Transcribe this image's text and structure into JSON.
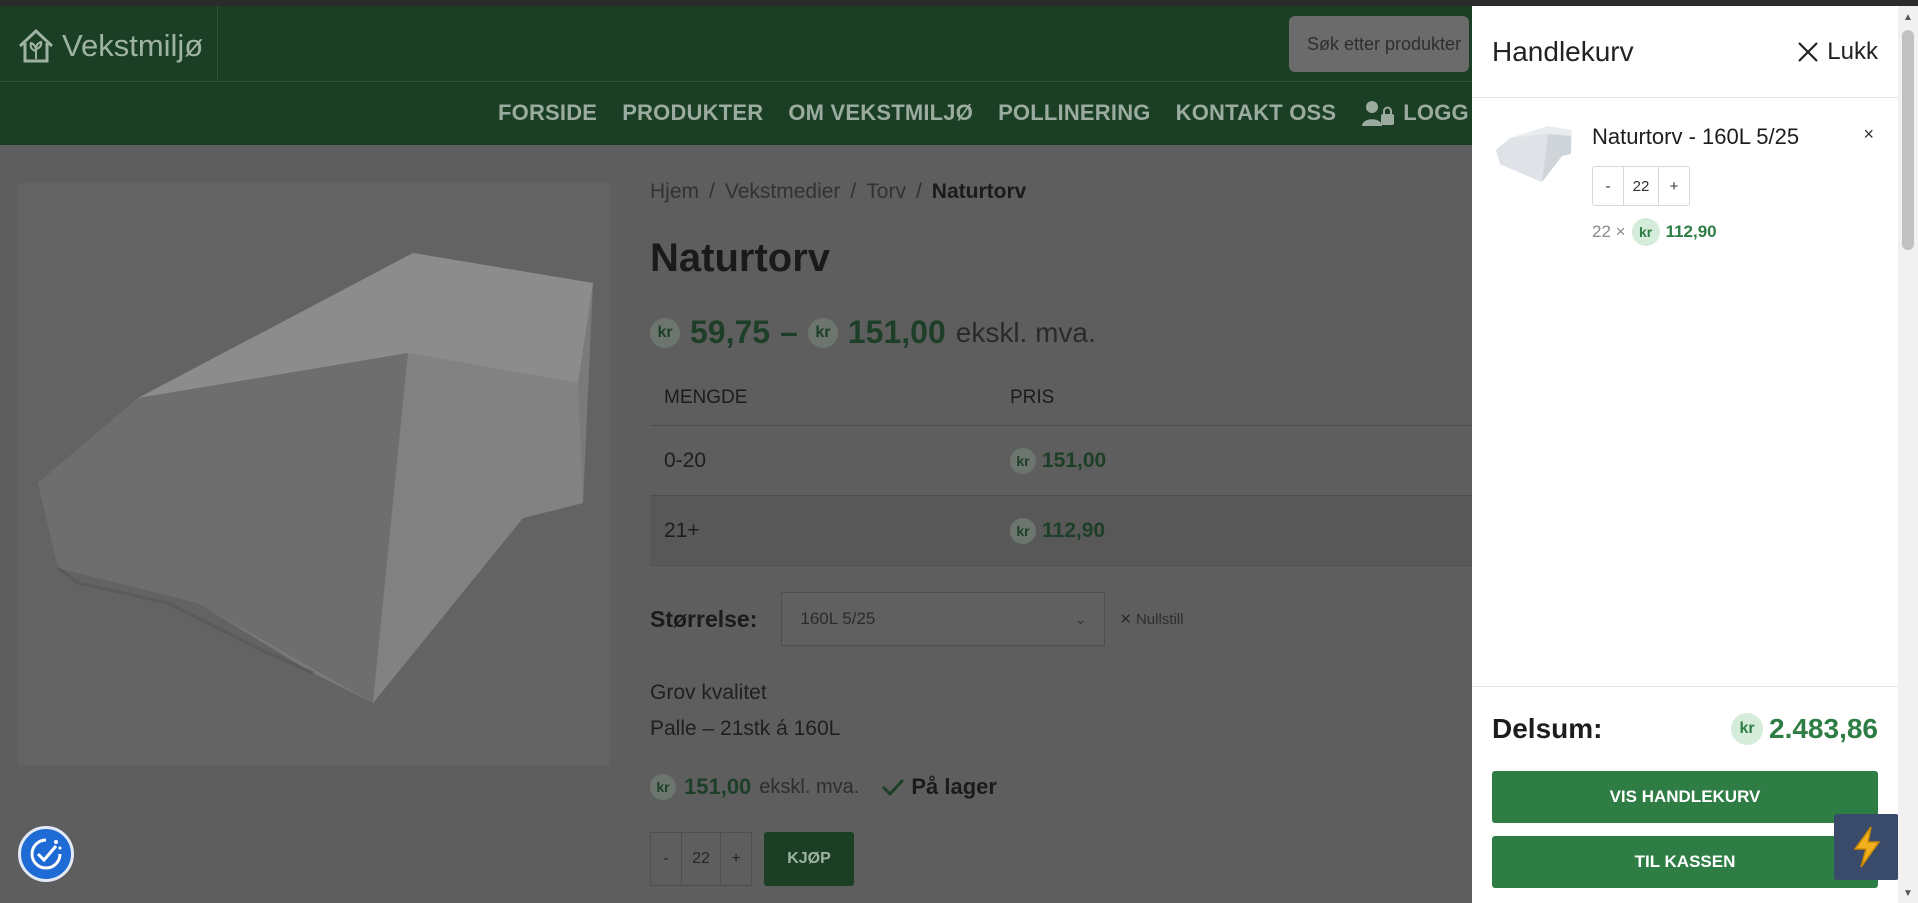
{
  "header": {
    "logo_text": "Vekstmiljø",
    "search_placeholder": "Søk etter produkter",
    "nav": [
      {
        "label": "FORSIDE"
      },
      {
        "label": "PRODUKTER"
      },
      {
        "label": "OM VEKSTMILJØ"
      },
      {
        "label": "POLLINERING"
      },
      {
        "label": "KONTAKT OSS"
      },
      {
        "label": "LOGG INN"
      }
    ]
  },
  "breadcrumb": [
    "Hjem",
    "Vekstmedier",
    "Torv",
    "Naturtorv"
  ],
  "breadcrumb_sep": "/",
  "product": {
    "title": "Naturtorv",
    "price_low": "59,75",
    "price_sep": "–",
    "price_high": "151,00",
    "price_suffix": "ekskl. mva.",
    "currency": "kr",
    "table": {
      "headers": [
        "MENGDE",
        "PRIS"
      ],
      "rows": [
        {
          "qty": "0-20",
          "price": "151,00"
        },
        {
          "qty": "21+",
          "price": "112,90"
        }
      ]
    },
    "size_label": "Størrelse:",
    "size_value": "160L 5/25",
    "reset_label": "Nullstill",
    "description": [
      "Grov kvalitet",
      "Palle – 21stk á 160L"
    ],
    "unit_price": "151,00",
    "unit_suffix": "ekskl. mva.",
    "stock": "På lager",
    "quantity": "22",
    "buy_label": "KJØP",
    "minus": "-",
    "plus": "+"
  },
  "cart": {
    "title": "Handlekurv",
    "close_label": "Lukk",
    "item": {
      "name": "Naturtorv - 160L 5/25",
      "qty": "22",
      "minus": "-",
      "plus": "+",
      "line_prefix": "22 ×",
      "line_amount": "112,90",
      "remove": "×"
    },
    "subtotal_label": "Delsum:",
    "subtotal_value": "2.483,86",
    "currency": "kr",
    "view_cart": "VIS HANDLEKURV",
    "checkout": "TIL KASSEN"
  },
  "colors": {
    "brand_green": "#2e7d45",
    "overlay_dark": "#5e5e5e",
    "accessibility_blue": "#1e6bd6"
  }
}
